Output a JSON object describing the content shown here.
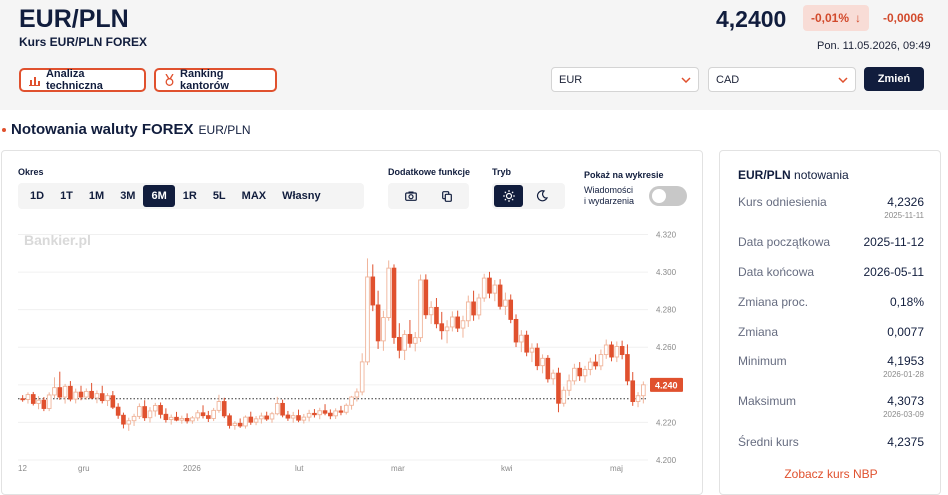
{
  "header": {
    "pair": "EUR/PLN",
    "subtitle": "Kurs EUR/PLN FOREX",
    "price": "4,2400",
    "change_pct": "-0,01%",
    "change_arrow": "↓",
    "change_abs": "-0,0006",
    "datetime": "Pon. 11.05.2026, 09:49",
    "btn_analysis": "Analiza techniczna",
    "btn_ranking": "Ranking kantorów",
    "select_from": "EUR",
    "select_to": "CAD",
    "btn_change": "Zmień"
  },
  "section": {
    "title": "Notowania waluty FOREX",
    "pair": "EUR/PLN"
  },
  "controls": {
    "period_label": "Okres",
    "periods": [
      "1D",
      "1T",
      "1M",
      "3M",
      "6M",
      "1R",
      "5L",
      "MAX",
      "Własny"
    ],
    "active_period": "6M",
    "extra_label": "Dodatkowe funkcje",
    "mode_label": "Tryb",
    "show_label": "Pokaż na wykresie",
    "toggle_label_1": "Wiadomości",
    "toggle_label_2": "i wydarzenia"
  },
  "chart_data": {
    "type": "candlestick",
    "watermark": "Bankier.pl",
    "y_ticks": [
      "4.320",
      "4.300",
      "4.280",
      "4.260",
      "4.240",
      "4.220",
      "4.200"
    ],
    "ylim": [
      4.192,
      4.324
    ],
    "x_labels": [
      "12",
      "gru",
      "2026",
      "lut",
      "mar",
      "kwi",
      "maj"
    ],
    "reference_value": 4.2326,
    "last_value": "4.240",
    "up_color": "#f0b49a",
    "down_color": "#e0512e",
    "candles": [
      [
        4.2326,
        4.2345,
        4.231,
        4.2322
      ],
      [
        4.2322,
        4.236,
        4.23,
        4.2348
      ],
      [
        4.2348,
        4.2362,
        4.229,
        4.2301
      ],
      [
        4.2301,
        4.234,
        4.227,
        4.2318
      ],
      [
        4.2318,
        4.2335,
        4.226,
        4.2274
      ],
      [
        4.2274,
        4.236,
        4.226,
        4.2346
      ],
      [
        4.2346,
        4.244,
        4.233,
        4.2385
      ],
      [
        4.2385,
        4.247,
        4.232,
        4.2335
      ],
      [
        4.2335,
        4.2405,
        4.23,
        4.2392
      ],
      [
        4.2392,
        4.242,
        4.2312,
        4.2324
      ],
      [
        4.2324,
        4.238,
        4.2301,
        4.2361
      ],
      [
        4.2361,
        4.2395,
        4.2318,
        4.2335
      ],
      [
        4.2335,
        4.2381,
        4.232,
        4.2365
      ],
      [
        4.2365,
        4.241,
        4.2324,
        4.233
      ],
      [
        4.233,
        4.237,
        4.2302,
        4.2353
      ],
      [
        4.2353,
        4.2395,
        4.2301,
        4.2316
      ],
      [
        4.2316,
        4.2356,
        4.2287,
        4.2342
      ],
      [
        4.2342,
        4.2367,
        4.2271,
        4.2281
      ],
      [
        4.2281,
        4.2302,
        4.2219,
        4.2238
      ],
      [
        4.2238,
        4.2252,
        4.2168,
        4.2191
      ],
      [
        4.2191,
        4.2225,
        4.2155,
        4.2209
      ],
      [
        4.2209,
        4.2246,
        4.2181,
        4.2232
      ],
      [
        4.2232,
        4.2301,
        4.2218,
        4.2284
      ],
      [
        4.2284,
        4.2318,
        4.2208,
        4.2225
      ],
      [
        4.2225,
        4.2281,
        4.2199,
        4.2261
      ],
      [
        4.2261,
        4.2304,
        4.2231,
        4.229
      ],
      [
        4.229,
        4.2306,
        4.2221,
        4.2243
      ],
      [
        4.2243,
        4.2275,
        4.2199,
        4.2215
      ],
      [
        4.2215,
        4.2242,
        4.2188,
        4.2227
      ],
      [
        4.2227,
        4.2256,
        4.2206,
        4.2212
      ],
      [
        4.2212,
        4.2236,
        4.2193,
        4.2221
      ],
      [
        4.2221,
        4.2248,
        4.2194,
        4.2208
      ],
      [
        4.2208,
        4.2234,
        4.2193,
        4.2224
      ],
      [
        4.2224,
        4.2266,
        4.2208,
        4.2251
      ],
      [
        4.2251,
        4.2291,
        4.2221,
        4.2236
      ],
      [
        4.2236,
        4.2261,
        4.2202,
        4.2221
      ],
      [
        4.2221,
        4.2277,
        4.2207,
        4.2264
      ],
      [
        4.2264,
        4.2347,
        4.2251,
        4.2311
      ],
      [
        4.2311,
        4.2331,
        4.2223,
        4.2235
      ],
      [
        4.2235,
        4.2248,
        4.2167,
        4.2184
      ],
      [
        4.2184,
        4.2207,
        4.2161,
        4.2195
      ],
      [
        4.2195,
        4.2221,
        4.2171,
        4.2181
      ],
      [
        4.2181,
        4.2237,
        4.2167,
        4.2228
      ],
      [
        4.2228,
        4.2257,
        4.2187,
        4.2201
      ],
      [
        4.2201,
        4.2234,
        4.2185,
        4.2219
      ],
      [
        4.2219,
        4.2252,
        4.2194,
        4.2234
      ],
      [
        4.2234,
        4.2257,
        4.2208,
        4.2218
      ],
      [
        4.2218,
        4.2256,
        4.2198,
        4.2246
      ],
      [
        4.2246,
        4.2336,
        4.2238,
        4.2301
      ],
      [
        4.2301,
        4.2321,
        4.2227,
        4.2239
      ],
      [
        4.2239,
        4.2261,
        4.2208,
        4.2223
      ],
      [
        4.2223,
        4.2256,
        4.2198,
        4.2236
      ],
      [
        4.2236,
        4.2268,
        4.2201,
        4.2212
      ],
      [
        4.2212,
        4.2245,
        4.2194,
        4.2228
      ],
      [
        4.2228,
        4.2267,
        4.2205,
        4.2248
      ],
      [
        4.2248,
        4.2271,
        4.2226,
        4.2241
      ],
      [
        4.2241,
        4.2278,
        4.2217,
        4.2262
      ],
      [
        4.2262,
        4.2297,
        4.2238,
        4.2249
      ],
      [
        4.2249,
        4.2269,
        4.2217,
        4.2235
      ],
      [
        4.2235,
        4.2275,
        4.2218,
        4.2261
      ],
      [
        4.2261,
        4.2288,
        4.2238,
        4.2254
      ],
      [
        4.2254,
        4.2301,
        4.2242,
        4.2291
      ],
      [
        4.2291,
        4.2341,
        4.2268,
        4.2335
      ],
      [
        4.2335,
        4.2381,
        4.2311,
        4.2362
      ],
      [
        4.2362,
        4.2568,
        4.2344,
        4.2522
      ],
      [
        4.2522,
        4.3073,
        4.2505,
        4.2974
      ],
      [
        4.2974,
        4.3041,
        4.2792,
        4.2825
      ],
      [
        4.2825,
        4.2901,
        4.2591,
        4.2634
      ],
      [
        4.2634,
        4.2794,
        4.2581,
        4.2758
      ],
      [
        4.2758,
        4.3062,
        4.2741,
        4.3021
      ],
      [
        4.3021,
        4.3041,
        4.2618,
        4.2652
      ],
      [
        4.2652,
        4.2728,
        4.2541,
        4.2584
      ],
      [
        4.2584,
        4.2691,
        4.2532,
        4.2668
      ],
      [
        4.2668,
        4.2745,
        4.2598,
        4.2621
      ],
      [
        4.2621,
        4.2681,
        4.2578,
        4.2651
      ],
      [
        4.2651,
        4.2987,
        4.2628,
        4.2958
      ],
      [
        4.2958,
        4.2988,
        4.2751,
        4.2773
      ],
      [
        4.2773,
        4.2845,
        4.2724,
        4.2812
      ],
      [
        4.2812,
        4.2862,
        4.2701,
        4.2725
      ],
      [
        4.2725,
        4.2788,
        4.2641,
        4.2688
      ],
      [
        4.2688,
        4.2744,
        4.2621,
        4.2708
      ],
      [
        4.2708,
        4.2791,
        4.2684,
        4.2761
      ],
      [
        4.2761,
        4.2795,
        4.2681,
        4.2702
      ],
      [
        4.2702,
        4.2768,
        4.2651,
        4.2741
      ],
      [
        4.2741,
        4.2875,
        4.2708,
        4.2841
      ],
      [
        4.2841,
        4.2901,
        4.2741,
        4.2772
      ],
      [
        4.2772,
        4.2885,
        4.2748,
        4.2862
      ],
      [
        4.2862,
        4.2991,
        4.2842,
        4.2968
      ],
      [
        4.2968,
        4.3001,
        4.2861,
        4.2888
      ],
      [
        4.2888,
        4.2958,
        4.2845,
        4.2931
      ],
      [
        4.2931,
        4.2962,
        4.2801,
        4.2818
      ],
      [
        4.2818,
        4.2891,
        4.2772,
        4.2851
      ],
      [
        4.2851,
        4.2881,
        4.2728,
        4.2748
      ],
      [
        4.2748,
        4.2775,
        4.2601,
        4.2628
      ],
      [
        4.2628,
        4.2691,
        4.2574,
        4.2664
      ],
      [
        4.2664,
        4.2688,
        4.2552,
        4.2574
      ],
      [
        4.2574,
        4.2621,
        4.2521,
        4.2595
      ],
      [
        4.2595,
        4.2621,
        4.2478,
        4.2502
      ],
      [
        4.2502,
        4.2562,
        4.2461,
        4.2541
      ],
      [
        4.2541,
        4.2558,
        4.2412,
        4.2432
      ],
      [
        4.2432,
        4.2481,
        4.2401,
        4.2462
      ],
      [
        4.2462,
        4.2491,
        4.2254,
        4.2302
      ],
      [
        4.2302,
        4.2391,
        4.2284,
        4.2371
      ],
      [
        4.2371,
        4.2455,
        4.2341,
        4.2421
      ],
      [
        4.2421,
        4.2512,
        4.2401,
        4.2488
      ],
      [
        4.2488,
        4.2521,
        4.2421,
        4.2448
      ],
      [
        4.2448,
        4.2501,
        4.2412,
        4.2482
      ],
      [
        4.2482,
        4.2544,
        4.2451,
        4.2521
      ],
      [
        4.2521,
        4.2562,
        4.2481,
        4.2501
      ],
      [
        4.2501,
        4.2588,
        4.2478,
        4.2561
      ],
      [
        4.2561,
        4.2641,
        4.2538,
        4.2612
      ],
      [
        4.2612,
        4.2631,
        4.2525,
        4.2548
      ],
      [
        4.2548,
        4.2631,
        4.2521,
        4.2604
      ],
      [
        4.2604,
        4.2635,
        4.2536,
        4.2561
      ],
      [
        4.2561,
        4.2615,
        4.2398,
        4.2421
      ],
      [
        4.2421,
        4.2468,
        4.2288,
        4.2311
      ],
      [
        4.2311,
        4.2361,
        4.2281,
        4.2342
      ],
      [
        4.2342,
        4.2418,
        4.2301,
        4.24
      ]
    ]
  },
  "sidebar": {
    "title_pair": "EUR/PLN",
    "title_rest": "notowania",
    "rows": [
      {
        "label": "Kurs odniesienia",
        "value": "4,2326",
        "date": "2025-11-11"
      },
      {
        "label": "Data początkowa",
        "value": "2025-11-12",
        "date": ""
      },
      {
        "label": "Data końcowa",
        "value": "2026-05-11",
        "date": ""
      },
      {
        "label": "Zmiana proc.",
        "value": "0,18%",
        "date": ""
      },
      {
        "label": "Zmiana",
        "value": "0,0077",
        "date": ""
      },
      {
        "label": "Minimum",
        "value": "4,1953",
        "date": "2026-01-28"
      },
      {
        "label": "Maksimum",
        "value": "4,3073",
        "date": "2026-03-09"
      },
      {
        "label": "Średni kurs",
        "value": "4,2375",
        "date": ""
      }
    ],
    "nbp_link": "Zobacz kurs NBP"
  }
}
